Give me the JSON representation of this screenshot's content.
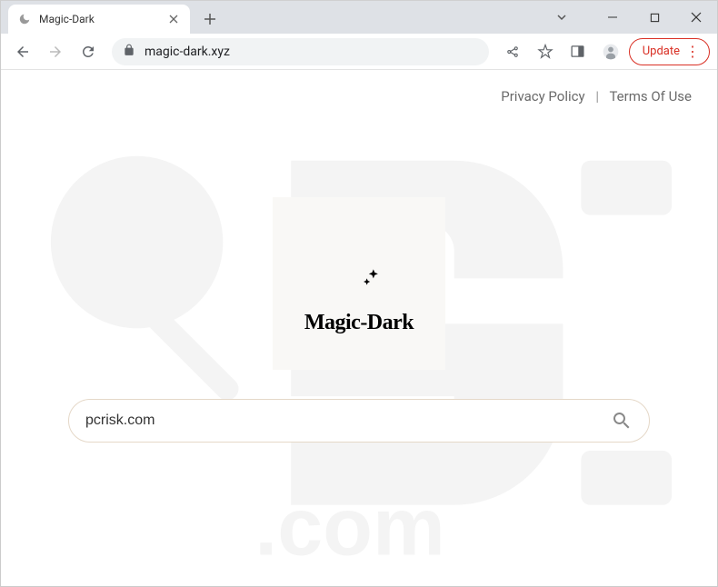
{
  "window": {
    "tab_title": "Magic-Dark"
  },
  "toolbar": {
    "url": "magic-dark.xyz",
    "update_label": "Update"
  },
  "header": {
    "privacy": "Privacy Policy",
    "terms": "Terms Of Use",
    "separator": "|"
  },
  "logo": {
    "brand": "Magic-Dark"
  },
  "search": {
    "value": "pcrisk.com"
  }
}
